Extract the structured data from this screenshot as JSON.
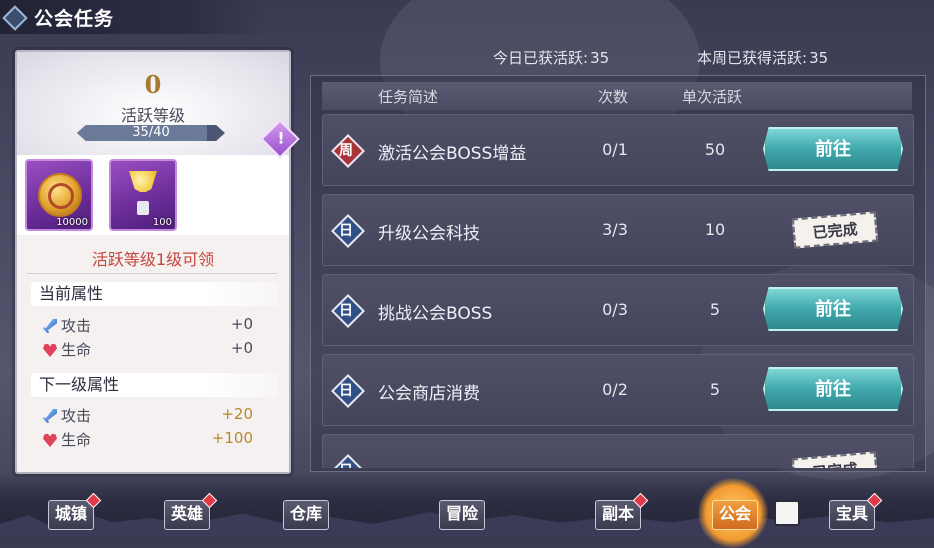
{
  "header": {
    "title": "公会任务"
  },
  "stats": {
    "today_label": "今日已获活跃:",
    "today_value": "35",
    "week_label": "本周已获得活跃:",
    "week_value": "35"
  },
  "left_panel": {
    "level": "0",
    "level_label": "活跃等级",
    "progress_text": "35/40",
    "progress_fraction": 0.875,
    "rewards": [
      {
        "icon": "gold-coin-icon",
        "qty": "10000"
      },
      {
        "icon": "trophy-icon",
        "qty": "100"
      }
    ],
    "claim_text": "活跃等级1级可领",
    "current_attr": {
      "title": "当前属性",
      "attack_label": "攻击",
      "attack_value": "+0",
      "hp_label": "生命",
      "hp_value": "+0"
    },
    "next_attr": {
      "title": "下一级属性",
      "attack_label": "攻击",
      "attack_value": "+20",
      "hp_label": "生命",
      "hp_value": "+100"
    },
    "alert_glyph": "!"
  },
  "table": {
    "headers": {
      "desc": "任务简述",
      "count": "次数",
      "activity": "单次活跃"
    },
    "rows": [
      {
        "badge": "周",
        "type": "week",
        "name": "激活公会BOSS增益",
        "count": "0/1",
        "activity": "50",
        "action": "前往",
        "done": false
      },
      {
        "badge": "日",
        "type": "day",
        "name": "升级公会科技",
        "count": "3/3",
        "activity": "10",
        "action": "已完成",
        "done": true
      },
      {
        "badge": "日",
        "type": "day",
        "name": "挑战公会BOSS",
        "count": "0/3",
        "activity": "5",
        "action": "前往",
        "done": false
      },
      {
        "badge": "日",
        "type": "day",
        "name": "公会商店消费",
        "count": "0/2",
        "activity": "5",
        "action": "前往",
        "done": false
      },
      {
        "badge": "日",
        "type": "day",
        "name": "",
        "count": "",
        "activity": "",
        "action": "已完成",
        "done": true
      }
    ]
  },
  "bottom_nav": {
    "items": [
      {
        "label": "城镇",
        "dot": true
      },
      {
        "label": "英雄",
        "dot": true
      },
      {
        "label": "仓库",
        "dot": false
      },
      {
        "label": "冒险",
        "dot": false
      },
      {
        "label": "副本",
        "dot": true
      },
      {
        "label": "公会",
        "dot": false,
        "active": true
      },
      {
        "label": "宝具",
        "dot": true
      }
    ]
  }
}
